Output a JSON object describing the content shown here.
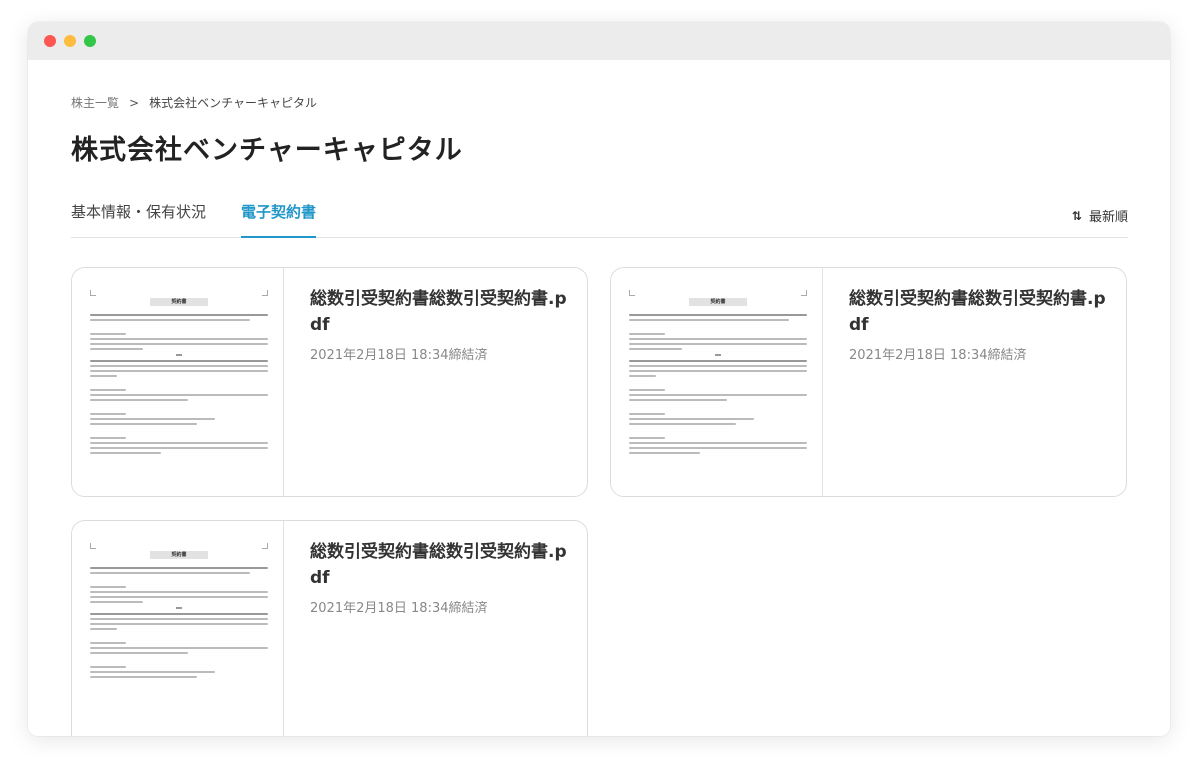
{
  "breadcrumb": {
    "parent": "株主一覧",
    "separator": ">",
    "current": "株式会社ベンチャーキャピタル"
  },
  "page": {
    "title": "株式会社ベンチャーキャピタル"
  },
  "tabs": [
    {
      "label": "基本情報・保有状況",
      "active": false
    },
    {
      "label": "電子契約書",
      "active": true
    }
  ],
  "sort": {
    "icon": "sort-icon",
    "label": "最新順"
  },
  "documents": [
    {
      "filename": "総数引受契約書総数引受契約書.pdf",
      "status": "2021年2月18日 18:34締結済",
      "thumbnail_title": "契約書"
    },
    {
      "filename": "総数引受契約書総数引受契約書.pdf",
      "status": "2021年2月18日 18:34締結済",
      "thumbnail_title": "契約書"
    },
    {
      "filename": "総数引受契約書総数引受契約書.pdf",
      "status": "2021年2月18日 18:34締結済",
      "thumbnail_title": "契約書"
    }
  ],
  "colors": {
    "accent": "#2196c9",
    "titlebar": "#ececec"
  }
}
